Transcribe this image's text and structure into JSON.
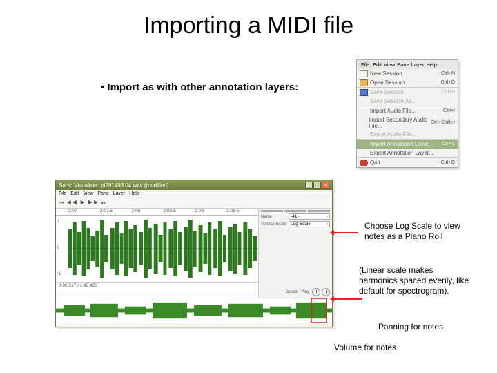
{
  "title": "Importing a MIDI file",
  "bullet": "Import as with other annotation layers:",
  "filemenu": {
    "bar": [
      "File",
      "Edit",
      "View",
      "Pane",
      "Layer",
      "Help"
    ],
    "items": [
      {
        "label": "New Session",
        "sc": "Ctrl+N",
        "ico": "ico-new"
      },
      {
        "label": "Open Session...",
        "sc": "Ctrl+O",
        "ico": "ico-open"
      },
      {
        "label": "Save Session",
        "sc": "Ctrl+S",
        "ico": "ico-save",
        "disabled": true,
        "sep": true
      },
      {
        "label": "Save Session As...",
        "sc": "",
        "disabled": true
      },
      {
        "label": "Import Audio File...",
        "sc": "Ctrl+I",
        "sep": true
      },
      {
        "label": "Import Secondary Audio File...",
        "sc": "Ctrl+Shift+I"
      },
      {
        "label": "Export Audio File...",
        "sc": "",
        "disabled": true
      },
      {
        "label": "Import Annotation Layer...",
        "sc": "Ctrl+L",
        "highlight": true,
        "sep": true
      },
      {
        "label": "Export Annotation Layer...",
        "sc": ""
      },
      {
        "label": "Quit",
        "sc": "Ctrl+Q",
        "ico": "ico-quit",
        "sep": true
      }
    ]
  },
  "app": {
    "title": "Sonic Visualiser: pl291493.04.wav (modified)",
    "menu": [
      "File",
      "Edit",
      "View",
      "Pane",
      "Layer",
      "Help"
    ],
    "ruler": [
      "2:07",
      "2:07.5",
      "2:08",
      "2:08.5",
      "2:09",
      "2:09.5"
    ],
    "side_tabs": [
      "",
      "",
      ""
    ],
    "side_name_label": "Name",
    "side_name_value": "-41:-",
    "side_scale_label": "Vertical Scale",
    "side_scale_value": "Log Scale",
    "bottom_speed": "Speed:",
    "bottom_play": "Play",
    "footer_left": "2:06.517 / 1:43.423"
  },
  "notes": {
    "a": "Choose Log Scale to view notes as a Piano Roll",
    "b": "(Linear scale makes harmonics spaced evenly, like default for spectrogram).",
    "c": "Panning  for notes",
    "d": "Volume for notes"
  }
}
